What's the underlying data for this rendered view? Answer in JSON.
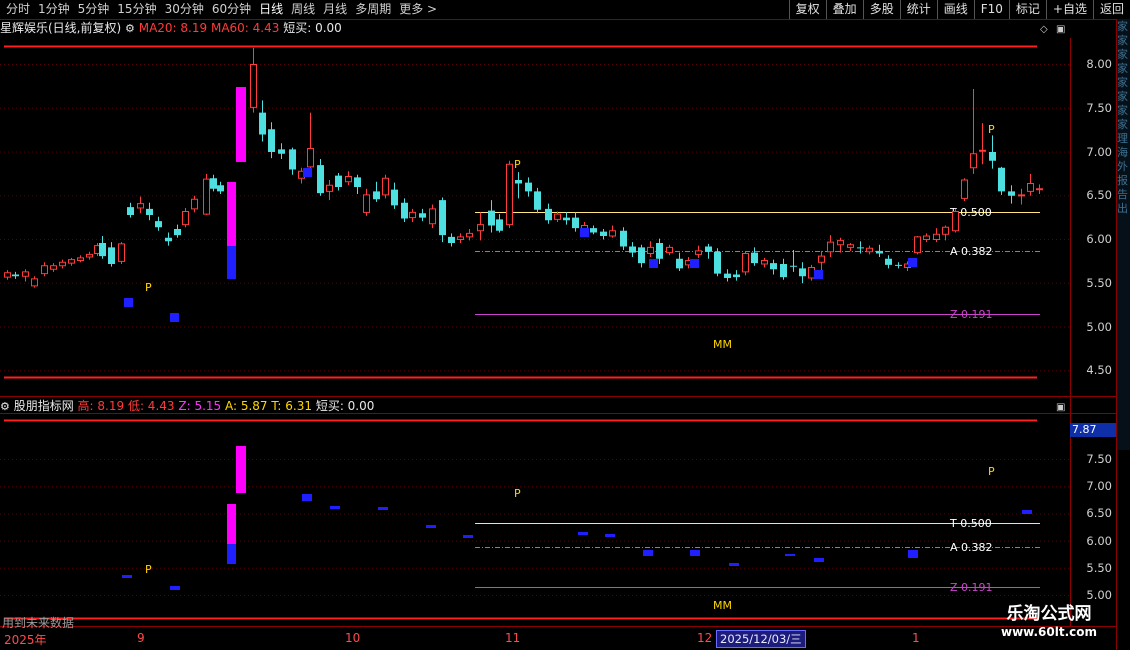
{
  "toolbar": {
    "periods": [
      "分时",
      "1分钟",
      "5分钟",
      "15分钟",
      "30分钟",
      "60分钟",
      "日线",
      "周线",
      "月线",
      "多周期",
      "更多 >"
    ],
    "active_period": "日线",
    "tools": [
      "复权",
      "叠加",
      "多股",
      "统计",
      "画线",
      "F10",
      "标记",
      "+自选",
      "返回"
    ]
  },
  "main_header": {
    "name": "星辉娱乐(日线,前复权)",
    "ma20": "MA20: 8.19",
    "ma60": "MA60: 4.43",
    "short_buy": "短买: 0.00"
  },
  "sub_header": {
    "name": "股朋指标网",
    "high": "高: 8.19",
    "low": "低: 4.43",
    "z": "Z: 5.15",
    "a": "A: 5.87",
    "t": "T: 6.31",
    "short_buy": "短买: 0.00"
  },
  "main_axis": [
    "8.00",
    "7.50",
    "7.00",
    "6.50",
    "6.00",
    "5.50",
    "5.00",
    "4.50"
  ],
  "sub_axis": [
    "7.50",
    "7.00",
    "6.50",
    "6.00",
    "5.50",
    "5.00"
  ],
  "price_tag": "7.87",
  "levels": {
    "t": "T 0.500",
    "a": "A 0.382",
    "z": "Z 0.191"
  },
  "markers": {
    "p": "P",
    "mm": "MM"
  },
  "dates": [
    "2025年",
    "9",
    "10",
    "11",
    "12",
    "1"
  ],
  "selected_date": "2025/12/03/三",
  "footnote": "用到未来数据",
  "logo": {
    "title": "乐淘公式网",
    "url": "www.60lt.com"
  },
  "right_panel_chars": [
    "家",
    "家",
    "家",
    "家",
    "家",
    "家",
    "家",
    "家",
    "理",
    "海",
    "外",
    "报",
    "告",
    "出"
  ],
  "colors": {
    "up": "#ff3b3b",
    "down": "#4ee0e0",
    "bg": "#000000",
    "gridline": "#8b0000",
    "t_line": "#ffe680",
    "z_line": "#cc44cc"
  }
}
